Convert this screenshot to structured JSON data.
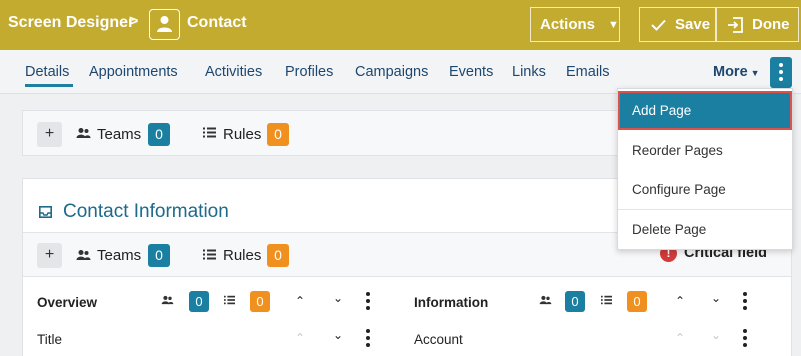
{
  "header": {
    "breadcrumb": "Screen Designer",
    "breadcrumb_separator": ">",
    "title": "Contact",
    "actions_label": "Actions",
    "save_label": "Save",
    "done_label": "Done"
  },
  "tabs": {
    "items": [
      "Details",
      "Appointments",
      "Activities",
      "Profiles",
      "Campaigns",
      "Events",
      "Links",
      "Emails"
    ],
    "active": "Details",
    "more_label": "More"
  },
  "panel1": {
    "add_symbol": "+",
    "teams_label": "Teams",
    "teams_count": "0",
    "rules_label": "Rules",
    "rules_count": "0"
  },
  "contact_section": {
    "title": "Contact Information",
    "add_symbol": "+",
    "teams_label": "Teams",
    "teams_count": "0",
    "rules_label": "Rules",
    "rules_count": "0",
    "critical_label": "Critical field",
    "critical_symbol": "!",
    "columns": [
      {
        "title": "Overview",
        "teams_count": "0",
        "rules_count": "0",
        "fields": [
          "Title"
        ]
      },
      {
        "title": "Information",
        "teams_count": "0",
        "rules_count": "0",
        "fields": [
          "Account"
        ]
      }
    ]
  },
  "dropdown": {
    "items": [
      "Add Page",
      "Reorder Pages",
      "Configure Page",
      "Delete Page"
    ],
    "highlighted": "Add Page"
  },
  "colors": {
    "header_bg": "#c3ab30",
    "accent_blue": "#1a7fa0",
    "badge_orange": "#f0901f",
    "critical_red": "#d13b3b",
    "tab_text": "#1e4770"
  }
}
